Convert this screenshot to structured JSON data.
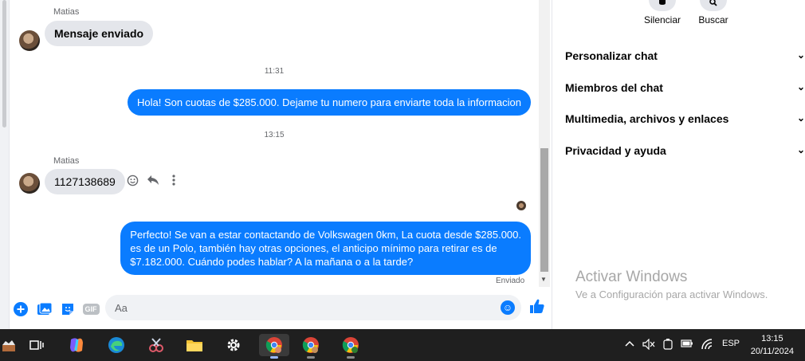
{
  "chat": {
    "messages": [
      {
        "sender": "Matias",
        "text": "Mensaje enviado"
      },
      {
        "time": "11:31"
      },
      {
        "outgoing": "Hola! Son cuotas de $285.000. Dejame tu numero para enviarte toda la informacion"
      },
      {
        "time": "13:15"
      },
      {
        "sender": "Matias",
        "text": "1127138689"
      },
      {
        "outgoing_lines": [
          "Perfecto!  Se van a estar contactando de Volkswagen 0km, La cuota desde $285.000.",
          "es de un Polo, también hay otras opciones, el anticipo mínimo para retirar es de",
          "$7.182.000. Cuándo podes hablar? A la mañana o a la tarde?"
        ]
      }
    ],
    "status": "Enviado"
  },
  "composer": {
    "placeholder": "Aa",
    "gif_label": "GIF"
  },
  "panel": {
    "top_actions": [
      {
        "label": "Silenciar",
        "icon": "bell-icon"
      },
      {
        "label": "Buscar",
        "icon": "search-icon"
      }
    ],
    "sections": [
      "Personalizar chat",
      "Miembros del chat",
      "Multimedia, archivos y enlaces",
      "Privacidad y ayuda"
    ]
  },
  "watermark": {
    "title": "Activar Windows",
    "subtitle": "Ve a Configuración para activar Windows."
  },
  "taskbar": {
    "language": "ESP",
    "time": "13:15",
    "date": "20/11/2024"
  },
  "colors": {
    "accent": "#0a7cff",
    "incoming_bubble": "#e4e6eb",
    "taskbar": "#1f1f1f"
  }
}
